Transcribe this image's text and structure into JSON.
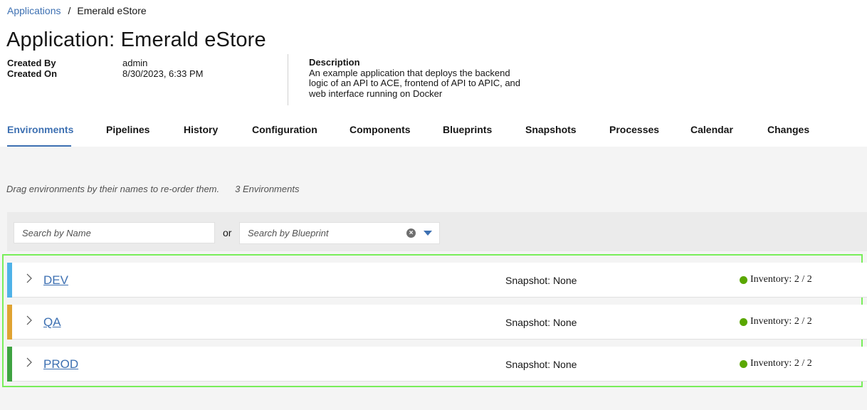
{
  "breadcrumb": {
    "parent": "Applications",
    "separator": "/",
    "current": "Emerald eStore"
  },
  "page_title": "Application: Emerald eStore",
  "meta": {
    "created_by_label": "Created By",
    "created_by_value": "admin",
    "created_on_label": "Created On",
    "created_on_value": "8/30/2023, 6:33 PM"
  },
  "description": {
    "label": "Description",
    "line1": "An example application that deploys the backend",
    "line2": "logic of an API to ACE, frontend of API to APIC, and",
    "line3": "web interface running on Docker"
  },
  "tabs": [
    {
      "label": "Environments",
      "active": true
    },
    {
      "label": "Pipelines"
    },
    {
      "label": "History"
    },
    {
      "label": "Configuration"
    },
    {
      "label": "Components"
    },
    {
      "label": "Blueprints"
    },
    {
      "label": "Snapshots"
    },
    {
      "label": "Processes"
    },
    {
      "label": "Calendar"
    },
    {
      "label": "Changes"
    }
  ],
  "hint": {
    "text": "Drag environments by their names to re-order them.",
    "count": "3 Environments"
  },
  "filters": {
    "name_placeholder": "Search by Name",
    "or_text": "or",
    "blueprint_placeholder": "Search by Blueprint",
    "clear_icon": "close-circle-icon",
    "dropdown_icon": "caret-down-icon"
  },
  "environments": [
    {
      "name": "DEV",
      "color": "#4fb2e8",
      "snapshot": "Snapshot: None",
      "inventory": "Inventory: 2 / 2",
      "status_color": "#5aa700"
    },
    {
      "name": "QA",
      "color": "#e0a332",
      "snapshot": "Snapshot: None",
      "inventory": "Inventory: 2 / 2",
      "status_color": "#5aa700"
    },
    {
      "name": "PROD",
      "color": "#3ea341",
      "snapshot": "Snapshot: None",
      "inventory": "Inventory: 2 / 2",
      "status_color": "#5aa700"
    }
  ],
  "colors": {
    "accent": "#3d70b2",
    "highlight": "#78ee5a"
  }
}
